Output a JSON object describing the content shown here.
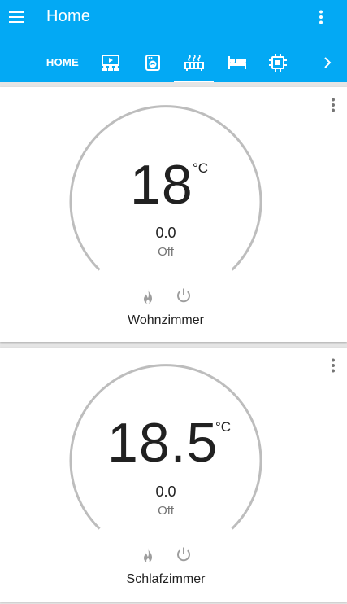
{
  "header": {
    "title": "Home",
    "menu_icon": "hamburger-menu-icon",
    "more_icon": "more-vertical-icon"
  },
  "tabs": {
    "home_label": "HOME",
    "icons": [
      "home-theater-icon",
      "washing-machine-icon",
      "radiator-icon",
      "bed-icon",
      "chip-icon",
      "chevron-right-icon"
    ],
    "active_index": 3
  },
  "colors": {
    "header_bg": "#03a9f4",
    "gauge_track": "#bdbdbd",
    "card_bg": "#ffffff",
    "page_bg": "#e5e5e5"
  },
  "thermostats": [
    {
      "target": "18",
      "unit": "°C",
      "current": "0.0",
      "mode": "Off",
      "name": "Wohnzimmer"
    },
    {
      "target": "18.5",
      "unit": "°C",
      "current": "0.0",
      "mode": "Off",
      "name": "Schlafzimmer"
    }
  ]
}
